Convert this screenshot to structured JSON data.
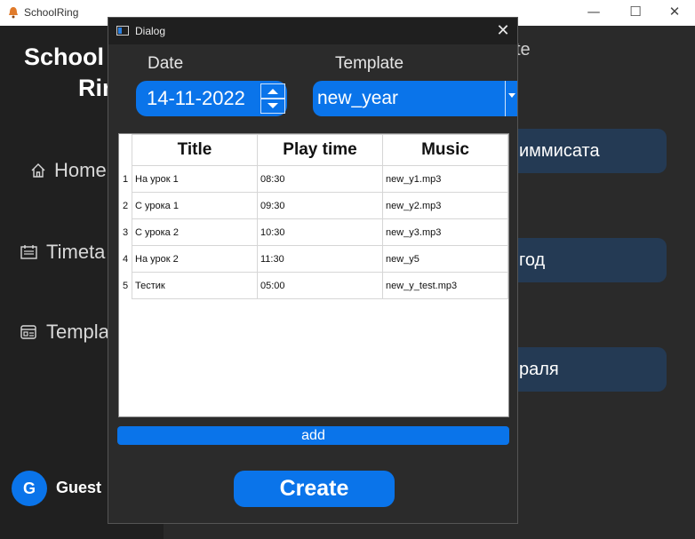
{
  "window": {
    "title": "SchoolRing",
    "controls": {
      "minimize": "—",
      "maximize": "☐",
      "close": "✕"
    }
  },
  "sidebar": {
    "brand_line1": "School",
    "brand_line2": "Rin",
    "items": [
      {
        "label": "Home",
        "icon": "home-icon"
      },
      {
        "label": "Timeta",
        "icon": "calendar-icon"
      },
      {
        "label": "Templa",
        "icon": "template-icon"
      }
    ],
    "user": {
      "initial": "G",
      "name": "Guest"
    }
  },
  "background": {
    "heading_fragment": "te",
    "template_cards": [
      "иммисата",
      "год",
      "раля"
    ]
  },
  "dialog": {
    "title": "Dialog",
    "close": "✕",
    "date_label": "Date",
    "date_value": "14-11-2022",
    "template_label": "Template",
    "template_value": "new_year",
    "table": {
      "columns": [
        "Title",
        "Play time",
        "Music"
      ],
      "rows": [
        {
          "n": "1",
          "title": "На урок 1",
          "time": "08:30",
          "music": "new_y1.mp3"
        },
        {
          "n": "2",
          "title": "С урока 1",
          "time": "09:30",
          "music": "new_y2.mp3"
        },
        {
          "n": "3",
          "title": "С урока 2",
          "time": "10:30",
          "music": "new_y3.mp3"
        },
        {
          "n": "4",
          "title": "На урок 2",
          "time": "11:30",
          "music": "new_y5"
        },
        {
          "n": "5",
          "title": "Тестик",
          "time": "05:00",
          "music": "new_y_test.mp3"
        }
      ]
    },
    "add_label": "add",
    "create_label": "Create"
  },
  "colors": {
    "accent": "#0a74ea",
    "card": "#243a54",
    "dark_bg": "#202020"
  }
}
